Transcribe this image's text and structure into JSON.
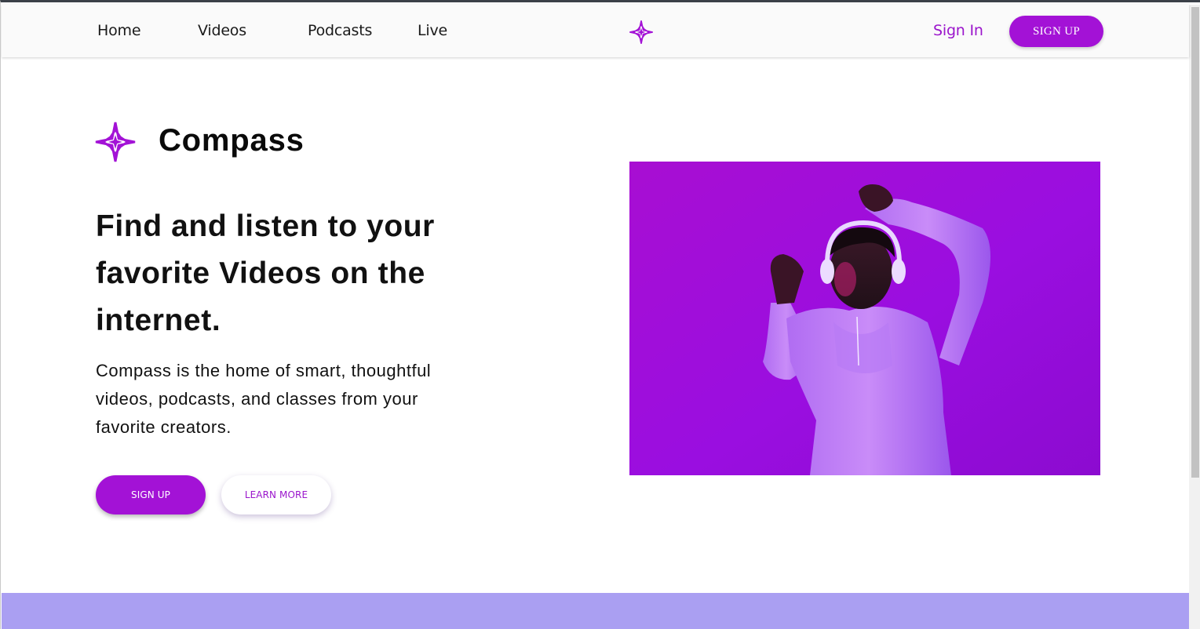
{
  "nav": {
    "links": [
      "Home",
      "Videos",
      "Podcasts",
      "Live"
    ],
    "logo_icon": "compass-star-icon",
    "sign_in": "Sign In",
    "sign_up": "SIGN UP"
  },
  "hero": {
    "brand_icon": "compass-star-icon",
    "brand_name": "Compass",
    "headline": "Find and listen to your favorite Videos on the internet.",
    "subtext": "Compass is the home of smart, thoughtful videos, podcasts, and classes from your favorite creators.",
    "primary_button": "SIGN UP",
    "secondary_button": "LEARN MORE"
  },
  "colors": {
    "accent": "#a312d6",
    "accent_text": "#9b16cc",
    "footer_band": "#aa9ff2",
    "navbar_bg": "#fafafa"
  }
}
